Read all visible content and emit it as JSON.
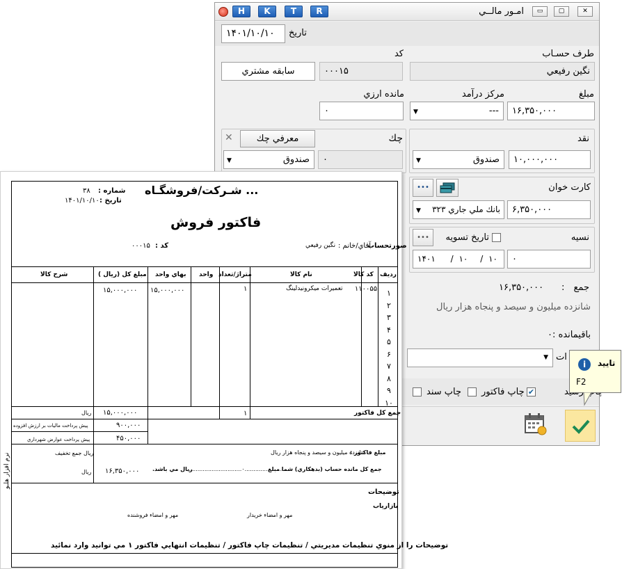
{
  "window": {
    "title": "امـور مالــي",
    "hk_buttons": [
      "H",
      "K",
      "T",
      "R"
    ],
    "min_glyph": "▭",
    "max_glyph": "▢",
    "close_glyph": "✕"
  },
  "date": {
    "label": "تاريخ",
    "value": "۱۴۰۱/۱۰/۱۰"
  },
  "party": {
    "label": "طرف حسـاب",
    "value": "نگين رفيعي",
    "code_label": "كد",
    "code_value": "۰۰۰۱۵",
    "history_button": "سابقه مشتري"
  },
  "amount": {
    "label": "مبلغ",
    "value": "۱۶,۳۵۰,۰۰۰",
    "income_label": "مركز درآمد",
    "income_value": "---",
    "fx_label": "مانده ارزي",
    "fx_value": "۰"
  },
  "cash": {
    "label": "نقد",
    "value": "۱۰,۰۰۰,۰۰۰",
    "box": "صندوق"
  },
  "check": {
    "label": "چك",
    "value": "۰",
    "box": "صندوق",
    "intro_button": "معرفي چك",
    "clear_glyph": "✕"
  },
  "card": {
    "label": "كارت خوان",
    "value": "۶,۳۵۰,۰۰۰",
    "bank": "بانك ملي جاري ۳۲۳",
    "more_glyph": "•••"
  },
  "credit": {
    "label": "نسيه",
    "value": "۰",
    "settle_label": "تاريخ تسويه",
    "date_parts": [
      "۱۴۰۱",
      "/",
      "۱۰",
      "/",
      "۱۰"
    ],
    "more_glyph": "•••"
  },
  "total": {
    "label": "جمع",
    "colon": ":",
    "value": "۱۶,۳۵۰,۰۰۰",
    "words": "شانزده ميليون  و سيصد و پنجاه هزار  ريال"
  },
  "remain": {
    "label": "باقيمانده :",
    "value": "۰"
  },
  "partial_label": "ات",
  "options": {
    "print_receipt": "چاپ رسيد",
    "print_invoice": "چاپ فاكتور",
    "print_doc": "چاپ سند",
    "partial": "پ"
  },
  "tooltip": {
    "title": "تاييد",
    "shortcut": "F2",
    "icon": "i"
  },
  "invoice": {
    "company": "... شـركت/فروشگـاه",
    "number_label": "شماره :",
    "number": "۳۸",
    "date_label": "تاريخ :",
    "date": "۱۴۰۱/۱۰/۱۰",
    "title": "فاكتور فروش",
    "account_label": "صورتحساب",
    "person_label": "آقاي/خانم :",
    "person": "نگين رفيعي",
    "code_label": "كد :",
    "code": "۰۰۰۱۵",
    "headers": {
      "row": "رديف",
      "code": "كد كالا",
      "name": "نام كالا",
      "qty": "متراژ/تعداد",
      "unit": "واحد",
      "price": "بهاي واحد",
      "total": "مبلغ كل (ريال )",
      "desc": "شرح كالا"
    },
    "rows": [
      "۱",
      "۲",
      "۳",
      "۴",
      "۵",
      "۶",
      "۷",
      "۸",
      "۹",
      "۱۰"
    ],
    "item": {
      "code": "۱۱۰۰۵۵",
      "name": "تعميرات ميكرونيدلينگ",
      "qty": "۱",
      "price": "۱۵,۰۰۰,۰۰۰",
      "total": "۱۵,۰۰۰,۰۰۰"
    },
    "sum_label": "جمع كل فاكتور",
    "sum_qty": "۱",
    "sum_total": "۱۵,۰۰۰,۰۰۰",
    "rial": "ريال",
    "vat_label": "پيش پرداخت ماليات بر ارزش افزوده",
    "vat": "۹۰۰,۰۰۰",
    "muni_label": "پيش پرداخت عوارض شهرداري",
    "muni": "۴۵۰,۰۰۰",
    "discount_label": "ريال جمع تخفيف",
    "net": "۱۶,۳۵۰,۰۰۰",
    "amount_label": "مبلغ فاكتور :",
    "amount_words": "شانزده ميليون و سيصد و پنجاه هزار  ريال",
    "balance_text": "جمع كل مانده حساب  (بدهكاري)  شما مبلغ",
    "balance_dots": "..............................۰.........................",
    "balance_end": "ريال مي باشد.",
    "notes": "توضيحات",
    "marketer": "بازارياب",
    "buyer_sign": "مهر و امضاء خريدار",
    "seller_sign": "مهر و امضاء فروشنده",
    "footer": "توضيحات را از منوي تنظيمات مديريتي / تنظيمات چاپ فاكتور / تنظيمات انتهايي فاكتور ۱ مي توانيد وارد نمائيد",
    "side_text": "نرم افزار هلـو"
  }
}
